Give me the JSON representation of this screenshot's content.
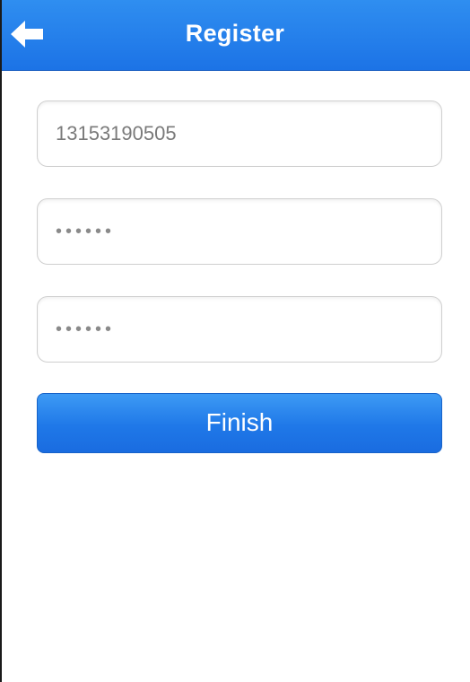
{
  "header": {
    "title": "Register",
    "back_icon": "arrow-left-icon"
  },
  "form": {
    "phone": {
      "value": "13153190505"
    },
    "password": {
      "value": "aaaaaa"
    },
    "confirm_password": {
      "value": "aaaaaa"
    },
    "finish_label": "Finish"
  },
  "colors": {
    "header_bg": "#1c73e6",
    "button_bg": "#1f78e8",
    "text": "#7a7a7a"
  }
}
